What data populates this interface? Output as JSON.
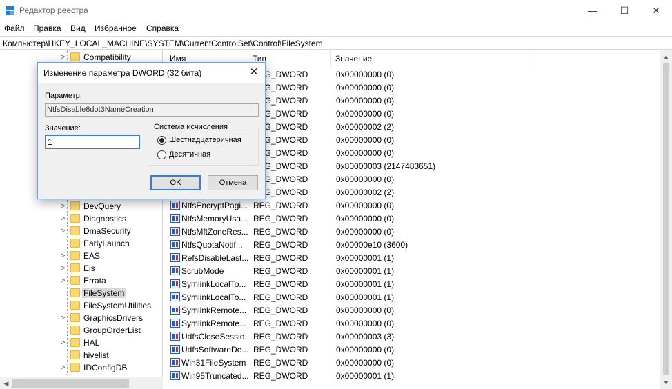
{
  "window": {
    "title": "Редактор реестра",
    "min_glyph": "—",
    "max_glyph": "☐",
    "close_glyph": "✕",
    "app_icon": "registry-icon"
  },
  "menu": [
    {
      "label_ul": "Ф",
      "label_rest": "айл"
    },
    {
      "label_ul": "П",
      "label_rest": "равка"
    },
    {
      "label_ul": "В",
      "label_rest": "ид"
    },
    {
      "label_ul": "И",
      "label_rest": "збранное"
    },
    {
      "label_ul": "С",
      "label_rest": "правка"
    }
  ],
  "address": "Компьютер\\HKEY_LOCAL_MACHINE\\SYSTEM\\CurrentControlSet\\Control\\FileSystem",
  "tree": {
    "items": [
      {
        "label": "Compatibility",
        "expandable": true,
        "selected": false
      },
      {
        "label": "DevQuery",
        "expandable": true,
        "selected": false
      },
      {
        "label": "Diagnostics",
        "expandable": true,
        "selected": false
      },
      {
        "label": "DmaSecurity",
        "expandable": true,
        "selected": false
      },
      {
        "label": "EarlyLaunch",
        "expandable": false,
        "selected": false
      },
      {
        "label": "EAS",
        "expandable": true,
        "selected": false
      },
      {
        "label": "Els",
        "expandable": true,
        "selected": false
      },
      {
        "label": "Errata",
        "expandable": true,
        "selected": false
      },
      {
        "label": "FileSystem",
        "expandable": false,
        "selected": true
      },
      {
        "label": "FileSystemUtilities",
        "expandable": false,
        "selected": false
      },
      {
        "label": "GraphicsDrivers",
        "expandable": true,
        "selected": false
      },
      {
        "label": "GroupOrderList",
        "expandable": false,
        "selected": false
      },
      {
        "label": "HAL",
        "expandable": true,
        "selected": false
      },
      {
        "label": "hivelist",
        "expandable": false,
        "selected": false
      },
      {
        "label": "IDConfigDB",
        "expandable": true,
        "selected": false
      }
    ]
  },
  "list": {
    "headers": {
      "name": "Имя",
      "type": "Тип",
      "value": "Значение"
    },
    "rows": [
      {
        "name": "",
        "type": "REG_DWORD",
        "value": "0x00000000 (0)"
      },
      {
        "name": "",
        "type": "REG_DWORD",
        "value": "0x00000000 (0)"
      },
      {
        "name": "",
        "type": "REG_DWORD",
        "value": "0x00000000 (0)"
      },
      {
        "name": "",
        "type": "REG_DWORD",
        "value": "0x00000000 (0)"
      },
      {
        "name": "",
        "type": "REG_DWORD",
        "value": "0x00000002 (2)"
      },
      {
        "name": "",
        "type": "REG_DWORD",
        "value": "0x00000000 (0)"
      },
      {
        "name": "",
        "type": "REG_DWORD",
        "value": "0x00000000 (0)"
      },
      {
        "name": "",
        "type": "REG_DWORD",
        "value": "0x80000003 (2147483651)"
      },
      {
        "name": "",
        "type": "REG_DWORD",
        "value": "0x00000000 (0)"
      },
      {
        "name": "",
        "type": "REG_DWORD",
        "value": "0x00000002 (2)"
      },
      {
        "name": "NtfsEncryptPagi...",
        "type": "REG_DWORD",
        "value": "0x00000000 (0)"
      },
      {
        "name": "NtfsMemoryUsa...",
        "type": "REG_DWORD",
        "value": "0x00000000 (0)"
      },
      {
        "name": "NtfsMftZoneRes...",
        "type": "REG_DWORD",
        "value": "0x00000000 (0)"
      },
      {
        "name": "NtfsQuotaNotif...",
        "type": "REG_DWORD",
        "value": "0x00000e10 (3600)"
      },
      {
        "name": "RefsDisableLast...",
        "type": "REG_DWORD",
        "value": "0x00000001 (1)"
      },
      {
        "name": "ScrubMode",
        "type": "REG_DWORD",
        "value": "0x00000001 (1)"
      },
      {
        "name": "SymlinkLocalTo...",
        "type": "REG_DWORD",
        "value": "0x00000001 (1)"
      },
      {
        "name": "SymlinkLocalTo...",
        "type": "REG_DWORD",
        "value": "0x00000001 (1)"
      },
      {
        "name": "SymlinkRemote...",
        "type": "REG_DWORD",
        "value": "0x00000000 (0)"
      },
      {
        "name": "SymlinkRemote...",
        "type": "REG_DWORD",
        "value": "0x00000000 (0)"
      },
      {
        "name": "UdfsCloseSessio...",
        "type": "REG_DWORD",
        "value": "0x00000003 (3)"
      },
      {
        "name": "UdfsSoftwareDe...",
        "type": "REG_DWORD",
        "value": "0x00000000 (0)"
      },
      {
        "name": "Win31FileSystem",
        "type": "REG_DWORD",
        "value": "0x00000000 (0)"
      },
      {
        "name": "Win95Truncated...",
        "type": "REG_DWORD",
        "value": "0x00000001 (1)"
      }
    ]
  },
  "dialog": {
    "title": "Изменение параметра DWORD (32 бита)",
    "close_glyph": "✕",
    "param_label": "Параметр:",
    "param_value": "NtfsDisable8dot3NameCreation",
    "value_label": "Значение:",
    "value": "1",
    "radix_legend": "Система исчисления",
    "radix_hex": "Шестнадцатеричная",
    "radix_dec": "Десятичная",
    "radix_selected": "hex",
    "ok": "OK",
    "cancel": "Отмена"
  },
  "scroll": {
    "left_glyph": "◀",
    "up_glyph": "▲",
    "down_glyph": "▼"
  }
}
